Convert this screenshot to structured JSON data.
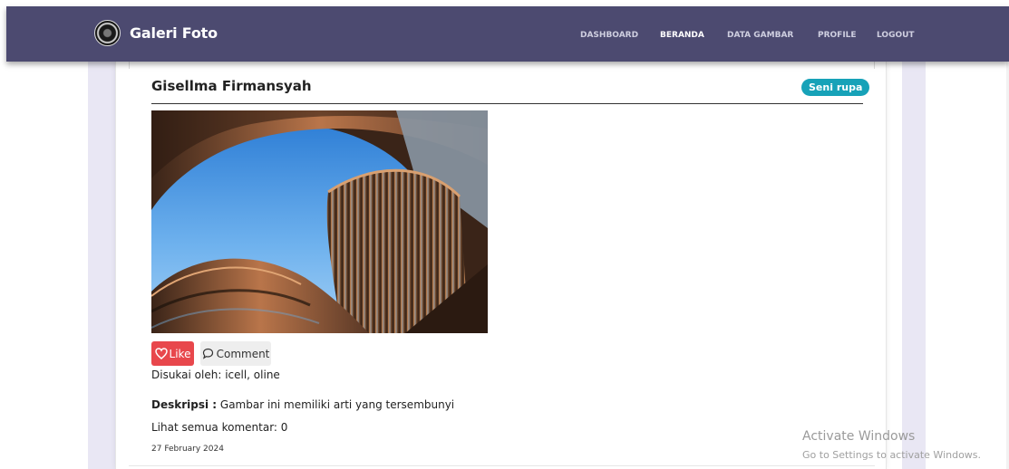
{
  "navbar": {
    "brand": "Galeri Foto",
    "menu": [
      "DASHBOARD",
      "BERANDA",
      "DATA GAMBAR",
      "PROFILE",
      "LOGOUT"
    ],
    "active": "BERANDA"
  },
  "post": {
    "author": "Gisellma Firmansyah",
    "category": "Seni rupa",
    "like_label": "Like",
    "comment_label": "Comment",
    "liked_by": "Disukai oleh: icell, oline",
    "description_label": "Deskripsi :",
    "description": " Gambar ini memiliki arti yang tersembunyi",
    "comments_link": "Lihat semua komentar: 0",
    "date": "27 February 2024"
  },
  "watermark": {
    "line1": "Activate Windows",
    "line2": "Go to Settings to activate Windows."
  },
  "colors": {
    "navbar": "#4c4a70",
    "like": "#e8474c",
    "badge": "#17a2b8",
    "side": "#e9e7f4"
  },
  "icons": {
    "brand": "camera-lens-icon",
    "like": "heart-icon",
    "comment": "speech-bubble-icon"
  }
}
